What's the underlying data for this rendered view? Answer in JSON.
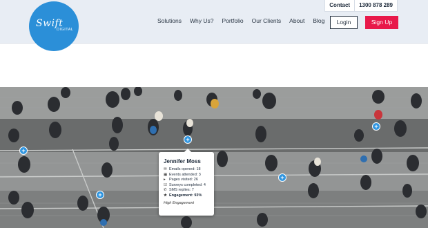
{
  "brand": {
    "script": "Swift",
    "sub": "DIGITAL",
    "color": "#2b8fd8"
  },
  "topbar": {
    "contact": "Contact",
    "phone": "1300 878 289"
  },
  "nav": {
    "items": [
      "Solutions",
      "Why Us?",
      "Portfolio",
      "Our Clients",
      "About",
      "Blog"
    ]
  },
  "buttons": {
    "login": "Login",
    "signup": "Sign Up",
    "signup_color": "#e8194a"
  },
  "hero": {
    "pin_glyph": "+"
  },
  "profile": {
    "name": "Jennifer Moss",
    "stats": [
      {
        "icon": "envelope-icon",
        "glyph": "✉",
        "text": "Emails opened: 18"
      },
      {
        "icon": "calendar-icon",
        "glyph": "▦",
        "text": "Events attended: 3"
      },
      {
        "icon": "page-icon",
        "glyph": "▸",
        "text": "Pages visited: 26"
      },
      {
        "icon": "survey-icon",
        "glyph": "☑",
        "text": "Surveys completed: 4"
      },
      {
        "icon": "sms-icon",
        "glyph": "✆",
        "text": "SMS replies: 7"
      },
      {
        "icon": "star-icon",
        "glyph": "★",
        "text": "Engagement: 93%"
      }
    ],
    "tag": "High Engagement"
  }
}
